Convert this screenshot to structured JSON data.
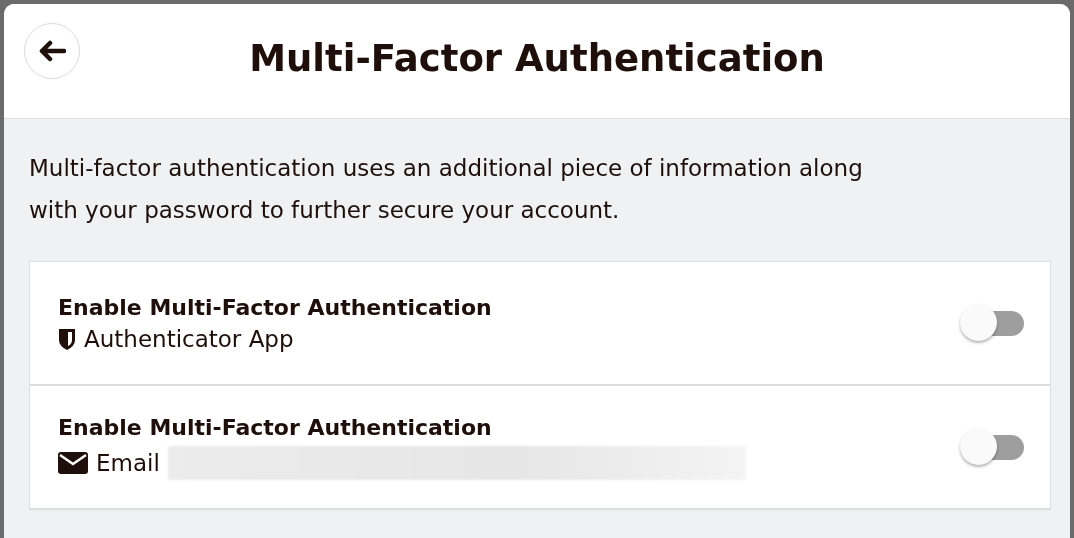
{
  "dialog": {
    "title": "Multi-Factor Authentication"
  },
  "description": "Multi-factor authentication uses an additional piece of information along with your password to further secure your account.",
  "options": [
    {
      "kind": "app",
      "title": "Enable Multi-Factor Authentication",
      "method": "Authenticator App",
      "on": false,
      "redacted": false
    },
    {
      "kind": "email",
      "title": "Enable Multi-Factor Authentication",
      "method": "Email",
      "on": false,
      "redacted": true
    }
  ]
}
